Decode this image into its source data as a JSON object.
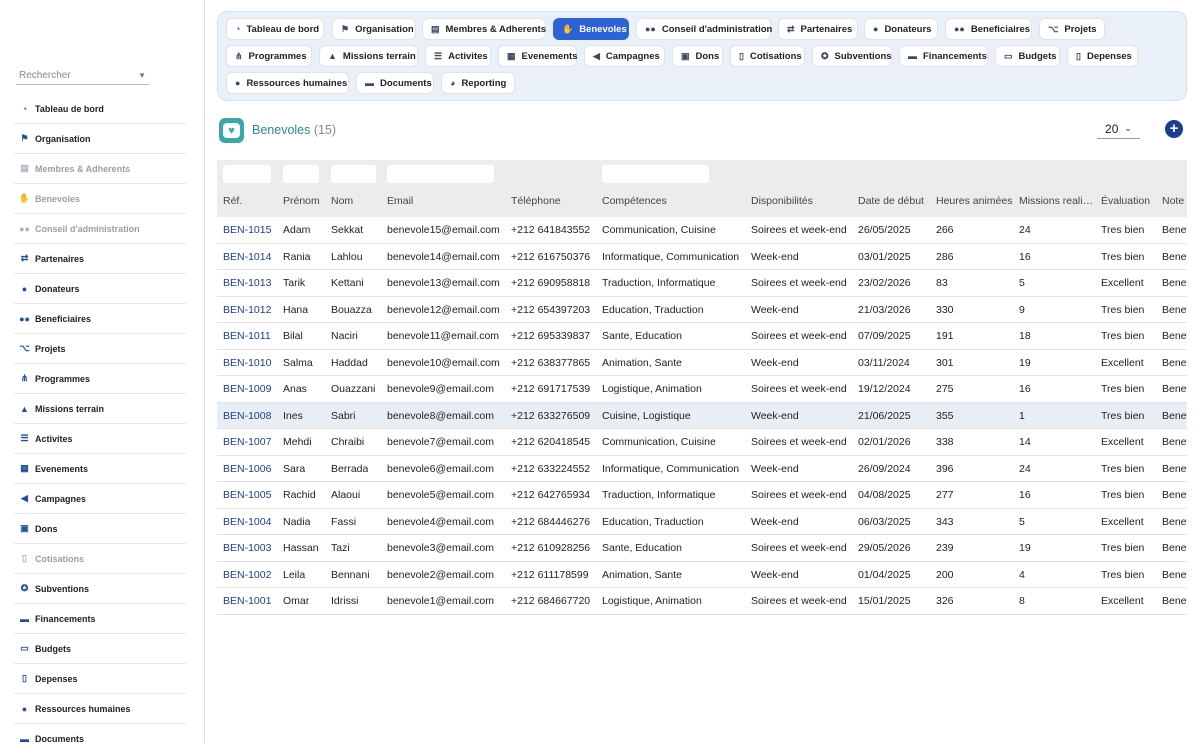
{
  "sidebar": {
    "search_placeholder": "Rechercher",
    "items": [
      {
        "label": "Tableau de bord",
        "icon": "dashboard-icon",
        "disabled": false
      },
      {
        "label": "Organisation",
        "icon": "flag-icon",
        "disabled": false
      },
      {
        "label": "Membres & Adherents",
        "icon": "id-card-icon",
        "disabled": true
      },
      {
        "label": "Benevoles",
        "icon": "hands-icon",
        "disabled": true
      },
      {
        "label": "Conseil d'administration",
        "icon": "users-icon",
        "disabled": true
      },
      {
        "label": "Partenaires",
        "icon": "handshake-icon",
        "disabled": false
      },
      {
        "label": "Donateurs",
        "icon": "person-icon",
        "disabled": false
      },
      {
        "label": "Beneficiaires",
        "icon": "people-icon",
        "disabled": false
      },
      {
        "label": "Projets",
        "icon": "project-icon",
        "disabled": false
      },
      {
        "label": "Programmes",
        "icon": "sitemap-icon",
        "disabled": false
      },
      {
        "label": "Missions terrain",
        "icon": "field-icon",
        "disabled": false
      },
      {
        "label": "Activites",
        "icon": "list-icon",
        "disabled": false
      },
      {
        "label": "Evenements",
        "icon": "calendar-icon",
        "disabled": false
      },
      {
        "label": "Campagnes",
        "icon": "megaphone-icon",
        "disabled": false
      },
      {
        "label": "Dons",
        "icon": "gift-icon",
        "disabled": false
      },
      {
        "label": "Cotisations",
        "icon": "receipt-icon",
        "disabled": true
      },
      {
        "label": "Subventions",
        "icon": "award-icon",
        "disabled": false
      },
      {
        "label": "Financements",
        "icon": "money-icon",
        "disabled": false
      },
      {
        "label": "Budgets",
        "icon": "wallet-icon",
        "disabled": false
      },
      {
        "label": "Depenses",
        "icon": "invoice-icon",
        "disabled": false
      },
      {
        "label": "Ressources humaines",
        "icon": "hr-icon",
        "disabled": false
      },
      {
        "label": "Documents",
        "icon": "folder-icon",
        "disabled": false
      }
    ]
  },
  "topnav": {
    "tabs": [
      {
        "label": "Tableau de bord",
        "icon": "dashboard-icon",
        "active": false
      },
      {
        "label": "Organisation",
        "icon": "flag-icon",
        "active": false
      },
      {
        "label": "Membres & Adherents",
        "icon": "id-card-icon",
        "active": false
      },
      {
        "label": "Benevoles",
        "icon": "hands-icon",
        "active": true
      },
      {
        "label": "Conseil d'administration",
        "icon": "users-icon",
        "active": false
      },
      {
        "label": "Partenaires",
        "icon": "handshake-icon",
        "active": false
      },
      {
        "label": "Donateurs",
        "icon": "person-icon",
        "active": false
      },
      {
        "label": "Beneficiaires",
        "icon": "people-icon",
        "active": false
      },
      {
        "label": "Projets",
        "icon": "project-icon",
        "active": false
      },
      {
        "label": "Programmes",
        "icon": "sitemap-icon",
        "active": false
      },
      {
        "label": "Missions terrain",
        "icon": "field-icon",
        "active": false
      },
      {
        "label": "Activites",
        "icon": "list-icon",
        "active": false
      },
      {
        "label": "Evenements",
        "icon": "calendar-icon",
        "active": false
      },
      {
        "label": "Campagnes",
        "icon": "megaphone-icon",
        "active": false
      },
      {
        "label": "Dons",
        "icon": "gift-icon",
        "active": false
      },
      {
        "label": "Cotisations",
        "icon": "receipt-icon",
        "active": false
      },
      {
        "label": "Subventions",
        "icon": "award-icon",
        "active": false
      },
      {
        "label": "Financements",
        "icon": "money-icon",
        "active": false
      },
      {
        "label": "Budgets",
        "icon": "wallet-icon",
        "active": false
      },
      {
        "label": "Depenses",
        "icon": "invoice-icon",
        "active": false
      },
      {
        "label": "Ressources humaines",
        "icon": "hr-icon",
        "active": false
      },
      {
        "label": "Documents",
        "icon": "folder-icon",
        "active": false
      },
      {
        "label": "Reporting",
        "icon": "chart-icon",
        "active": false
      }
    ]
  },
  "page": {
    "title": "Benevoles",
    "count": "(15)",
    "page_size": "20",
    "add_icon": "plus-circle-icon",
    "logo_icon": "heart-hands-icon"
  },
  "table": {
    "columns": [
      "Réf.",
      "Prénom",
      "Nom",
      "Email",
      "Téléphone",
      "Compétences",
      "Disponibilités",
      "Date de début",
      "Heures animées",
      "Missions realisees",
      "Évaluation",
      "Note"
    ],
    "rows": [
      [
        "BEN-1015",
        "Adam",
        "Sekkat",
        "benevole15@email.com",
        "+212 641843552",
        "Communication, Cuisine",
        "Soirees et week-end",
        "26/05/2025",
        "266",
        "24",
        "Tres bien",
        "Benevole"
      ],
      [
        "BEN-1014",
        "Rania",
        "Lahlou",
        "benevole14@email.com",
        "+212 616750376",
        "Informatique, Communication",
        "Week-end",
        "03/01/2025",
        "286",
        "16",
        "Tres bien",
        "Benevole"
      ],
      [
        "BEN-1013",
        "Tarik",
        "Kettani",
        "benevole13@email.com",
        "+212 690958818",
        "Traduction, Informatique",
        "Soirees et week-end",
        "23/02/2026",
        "83",
        "5",
        "Excellent",
        "Benevole"
      ],
      [
        "BEN-1012",
        "Hana",
        "Bouazza",
        "benevole12@email.com",
        "+212 654397203",
        "Education, Traduction",
        "Week-end",
        "21/03/2026",
        "330",
        "9",
        "Tres bien",
        "Benevole"
      ],
      [
        "BEN-1011",
        "Bilal",
        "Naciri",
        "benevole11@email.com",
        "+212 695339837",
        "Sante, Education",
        "Soirees et week-end",
        "07/09/2025",
        "191",
        "18",
        "Tres bien",
        "Benevole"
      ],
      [
        "BEN-1010",
        "Salma",
        "Haddad",
        "benevole10@email.com",
        "+212 638377865",
        "Animation, Sante",
        "Week-end",
        "03/11/2024",
        "301",
        "19",
        "Excellent",
        "Benevole"
      ],
      [
        "BEN-1009",
        "Anas",
        "Ouazzani",
        "benevole9@email.com",
        "+212 691717539",
        "Logistique, Animation",
        "Soirees et week-end",
        "19/12/2024",
        "275",
        "16",
        "Tres bien",
        "Benevole"
      ],
      [
        "BEN-1008",
        "Ines",
        "Sabri",
        "benevole8@email.com",
        "+212 633276509",
        "Cuisine, Logistique",
        "Week-end",
        "21/06/2025",
        "355",
        "1",
        "Tres bien",
        "Benevole"
      ],
      [
        "BEN-1007",
        "Mehdi",
        "Chraibi",
        "benevole7@email.com",
        "+212 620418545",
        "Communication, Cuisine",
        "Soirees et week-end",
        "02/01/2026",
        "338",
        "14",
        "Excellent",
        "Benevole"
      ],
      [
        "BEN-1006",
        "Sara",
        "Berrada",
        "benevole6@email.com",
        "+212 633224552",
        "Informatique, Communication",
        "Week-end",
        "26/09/2024",
        "396",
        "24",
        "Tres bien",
        "Benevole"
      ],
      [
        "BEN-1005",
        "Rachid",
        "Alaoui",
        "benevole5@email.com",
        "+212 642765934",
        "Traduction, Informatique",
        "Soirees et week-end",
        "04/08/2025",
        "277",
        "16",
        "Tres bien",
        "Benevole"
      ],
      [
        "BEN-1004",
        "Nadia",
        "Fassi",
        "benevole4@email.com",
        "+212 684446276",
        "Education, Traduction",
        "Week-end",
        "06/03/2025",
        "343",
        "5",
        "Excellent",
        "Benevole"
      ],
      [
        "BEN-1003",
        "Hassan",
        "Tazi",
        "benevole3@email.com",
        "+212 610928256",
        "Sante, Education",
        "Soirees et week-end",
        "29/05/2026",
        "239",
        "19",
        "Tres bien",
        "Benevole"
      ],
      [
        "BEN-1002",
        "Leila",
        "Bennani",
        "benevole2@email.com",
        "+212 611178599",
        "Animation, Sante",
        "Week-end",
        "01/04/2025",
        "200",
        "4",
        "Tres bien",
        "Benevole"
      ],
      [
        "BEN-1001",
        "Omar",
        "Idrissi",
        "benevole1@email.com",
        "+212 684667720",
        "Logistique, Animation",
        "Soirees et week-end",
        "15/01/2025",
        "326",
        "8",
        "Excellent",
        "Benevole"
      ]
    ],
    "highlighted_row": 7
  },
  "colors": {
    "accent": "#2e63d8",
    "nav_bg": "#e9f0f7",
    "ref_link": "#1d3f8a",
    "title_teal": "#2d8a8a"
  }
}
